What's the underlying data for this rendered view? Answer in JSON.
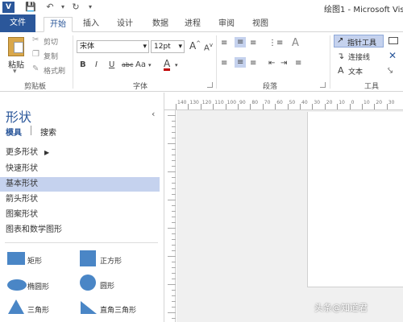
{
  "titlebar": {
    "app_icon": "V",
    "title": "绘图1 - Microsoft Vis"
  },
  "tabs": [
    "文件",
    "开始",
    "插入",
    "设计",
    "数据",
    "进程",
    "审阅",
    "视图"
  ],
  "clipboard": {
    "paste": "粘贴",
    "cut": "剪切",
    "copy": "复制",
    "format_painter": "格式刷",
    "group": "剪贴板"
  },
  "font": {
    "name": "宋体",
    "size": "12pt",
    "bold": "B",
    "italic": "I",
    "underline": "U",
    "strike": "abc",
    "case": "Aa",
    "color_a": "A",
    "grow": "A",
    "shrink": "A",
    "group": "字体"
  },
  "paragraph": {
    "group": "段落"
  },
  "tools": {
    "pointer": "指针工具",
    "connector": "连接线",
    "text": "文本",
    "text_icon": "A",
    "group": "工具"
  },
  "pane": {
    "title": "形状",
    "tab_models": "模具",
    "tab_search": "搜索",
    "stencils": [
      "更多形状",
      "快速形状",
      "基本形状",
      "箭头形状",
      "图案形状",
      "图表和数学图形"
    ],
    "selected_index": 2,
    "shapes": [
      "矩形",
      "正方形",
      "椭圆形",
      "圆形",
      "三角形",
      "直角三角形"
    ]
  },
  "ruler_h": [
    "140",
    "130",
    "120",
    "110",
    "100",
    "90",
    "80",
    "70",
    "60",
    "50",
    "40",
    "30",
    "20",
    "10",
    "0",
    "10",
    "20",
    "30"
  ],
  "watermark": "头条@知道君",
  "colors": {
    "accent": "#2b579a",
    "selection": "#c5d2ee",
    "shape_fill": "#4a86c6"
  }
}
